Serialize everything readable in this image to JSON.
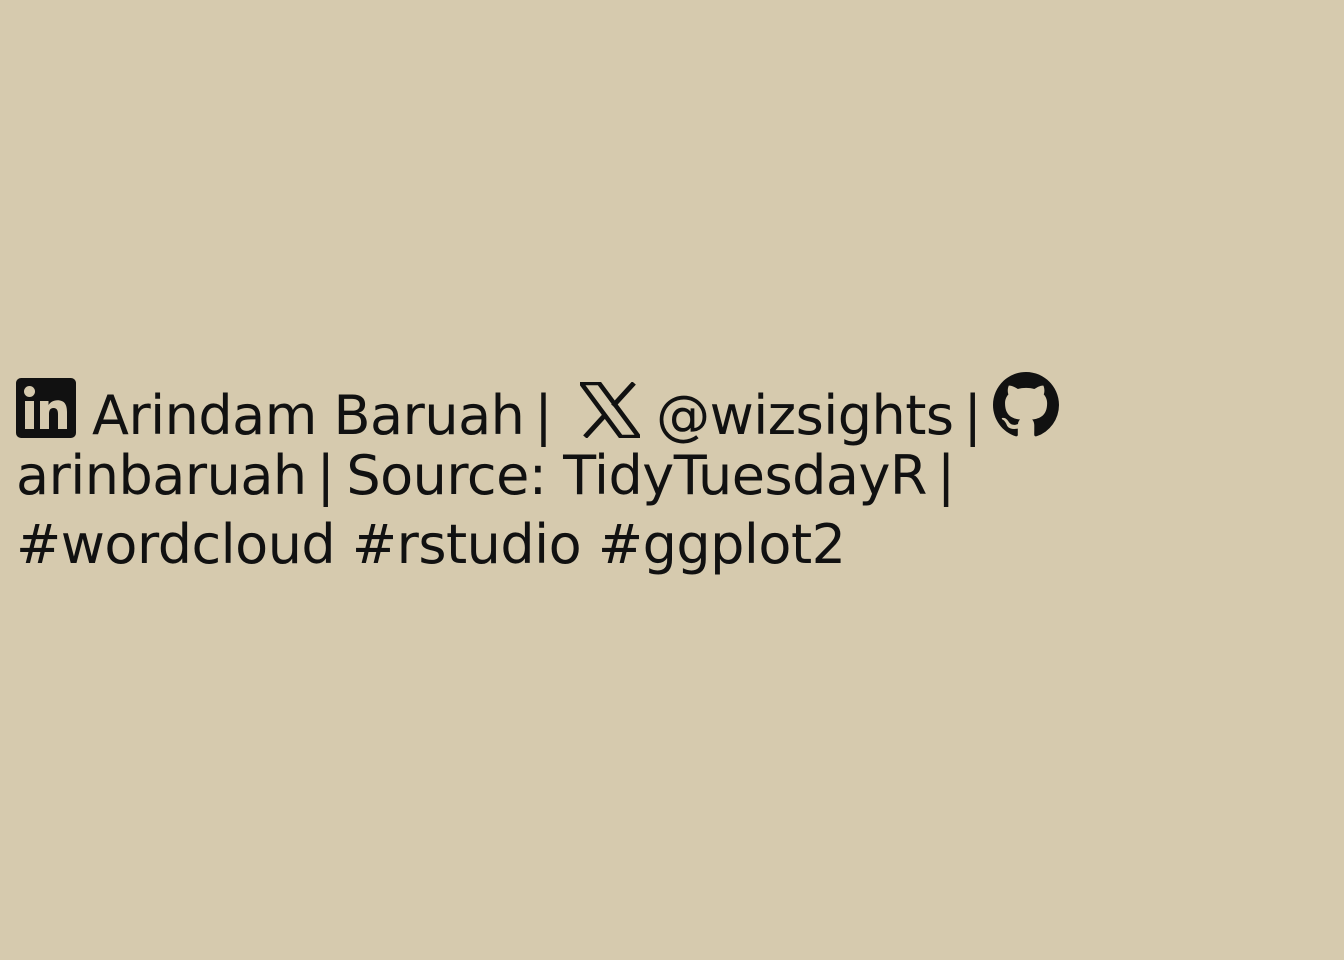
{
  "caption": {
    "author_name": "Arindam Baruah",
    "separator": "|",
    "twitter_handle": "@wizsights",
    "github_username": "arinbaruah",
    "source_text": "Source: TidyTuesdayR",
    "hashtags": "#wordcloud #rstudio #ggplot2"
  },
  "icons": {
    "linkedin": "linkedin-icon",
    "x": "x-twitter-icon",
    "github": "github-icon"
  },
  "colors": {
    "background": "#D6CAAE",
    "text": "#111111"
  }
}
